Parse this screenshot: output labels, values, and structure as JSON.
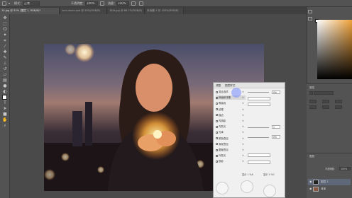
{
  "options_bar": {
    "mode_label": "模式：",
    "mode_value": "正常",
    "opacity_label": "不透明度：",
    "opacity_value": "100%",
    "flow_label": "流量：",
    "flow_value": "100%"
  },
  "tabs": [
    {
      "label": "10.jpg @ 55% (图层 1, RGB/8)*",
      "active": true
    },
    {
      "label": "lumi-stock.psd @ 50%(RGB/8)",
      "active": false
    },
    {
      "label": "16/d.jpg @ 66.7%(RGB/8)",
      "active": false
    },
    {
      "label": "未标题-1 @ 100%(RGB/8)",
      "active": false
    }
  ],
  "tools": [
    "move-icon",
    "marquee-icon",
    "lasso-icon",
    "magic-wand-icon",
    "crop-icon",
    "eyedropper-icon",
    "healing-icon",
    "brush-icon",
    "stamp-icon",
    "history-brush-icon",
    "eraser-icon",
    "gradient-icon",
    "blur-icon",
    "dodge-icon",
    "pen-icon",
    "type-icon",
    "path-select-icon",
    "shape-icon",
    "hand-icon",
    "zoom-icon"
  ],
  "colors": {
    "foreground": "#ffffff",
    "background": "#e0532a",
    "accent_picker": "#f0a23a"
  },
  "dialog": {
    "tabs": [
      "调整",
      "图层样式"
    ],
    "styles": [
      {
        "label": "混合选项",
        "checked": false
      },
      {
        "label": "斜面和浮雕",
        "checked": true,
        "active": true
      },
      {
        "label": "等高线",
        "checked": false
      },
      {
        "label": "纹理",
        "checked": false
      },
      {
        "label": "描边",
        "checked": false
      },
      {
        "label": "内阴影",
        "checked": false
      },
      {
        "label": "内发光",
        "checked": false
      },
      {
        "label": "光泽",
        "checked": false
      },
      {
        "label": "颜色叠加",
        "checked": false
      },
      {
        "label": "渐变叠加",
        "checked": false
      },
      {
        "label": "图案叠加",
        "checked": false
      },
      {
        "label": "外发光",
        "checked": true
      },
      {
        "label": "投影",
        "checked": false
      }
    ],
    "opacity_value": "0%",
    "size_value": "1",
    "fill_value": "0%",
    "bottom_checks": [
      "显示 1 %A",
      "显示 1 %0"
    ]
  },
  "panels": {
    "properties_title": "属性",
    "layers_title": "图层",
    "layer_name": "图层 1",
    "layer_name_2": "背景",
    "opacity_label": "不透明度：",
    "opacity_value": "100%"
  }
}
